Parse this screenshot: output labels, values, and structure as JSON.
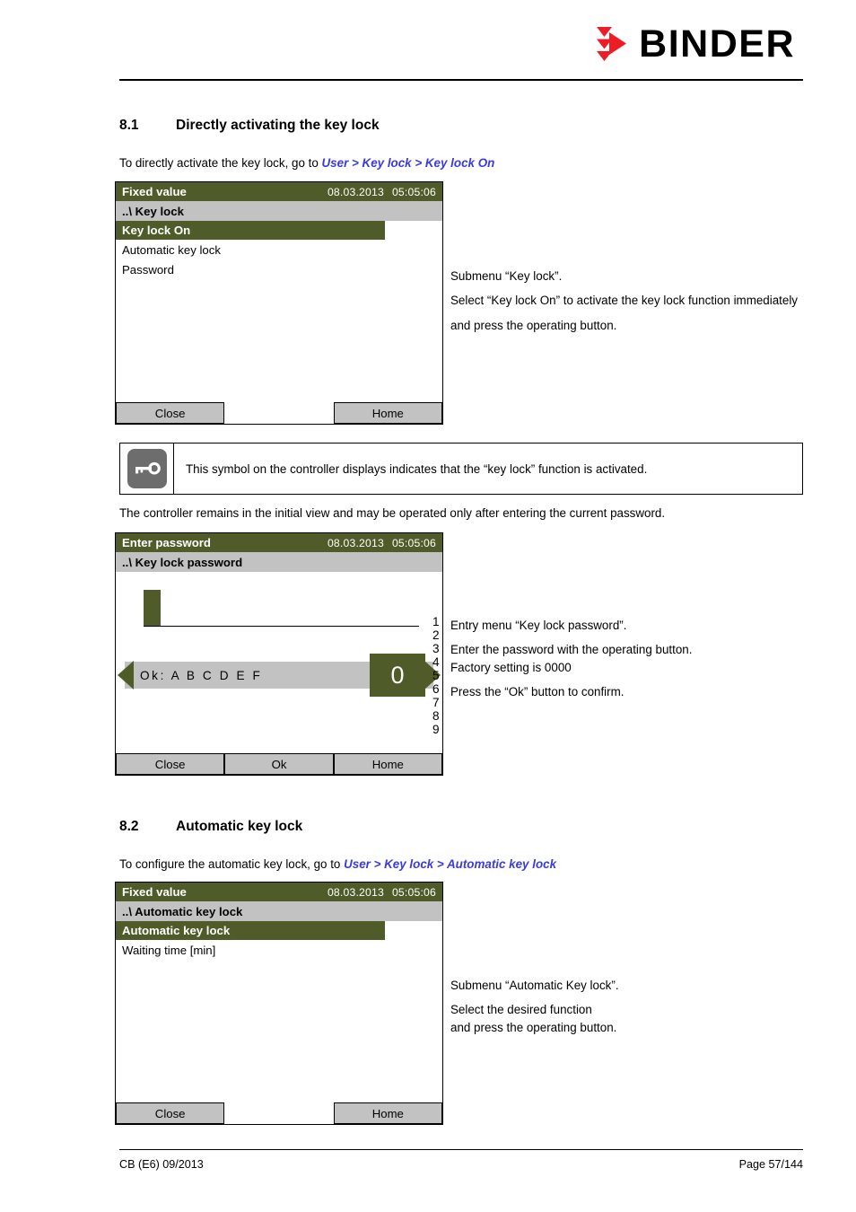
{
  "brand": {
    "name": "BINDER",
    "mark_color": "#ee1c24"
  },
  "sections": [
    {
      "number": "8.1",
      "title": "Directly activating the key lock",
      "intro_prefix": "To directly activate the key lock, go to ",
      "intro_path": "User > Key lock > Key lock On"
    },
    {
      "number": "8.2",
      "title": "Automatic key lock",
      "intro_prefix": "To configure the automatic key lock, go to ",
      "intro_path": "User > Key lock > Automatic key lock"
    }
  ],
  "panel_keylock": {
    "title": "Fixed value",
    "date": "08.03.2013",
    "time": "05:05:06",
    "breadcrumb": "..\\ Key lock",
    "selected_row": "Key lock On",
    "rows": [
      "Automatic key lock",
      "Password"
    ],
    "buttons": {
      "close": "Close",
      "home": "Home"
    }
  },
  "panel_password": {
    "title": "Enter password",
    "date": "08.03.2013",
    "time": "05:05:06",
    "breadcrumb": "..\\ Key lock password",
    "char_left": "Ok: A B C D E F",
    "char_selected": "0",
    "char_right": "1 2 3 4 5 6 7 8 9",
    "buttons": {
      "close": "Close",
      "ok": "Ok",
      "home": "Home"
    }
  },
  "panel_autolock": {
    "title": "Fixed value",
    "date": "08.03.2013",
    "time": "05:05:06",
    "breadcrumb": "..\\ Automatic key lock",
    "selected_row": "Automatic key lock",
    "rows": [
      "Waiting time [min]"
    ],
    "buttons": {
      "close": "Close",
      "home": "Home"
    }
  },
  "notes": {
    "keylock": {
      "line1": "Submenu “Key lock”.",
      "line2": "Select “Key lock On” to activate the key lock function immediately",
      "line3": "and press the operating button."
    },
    "password": {
      "line1": "Entry menu “Key lock password”.",
      "line2": "Enter the password with the operating button.",
      "line3": "Factory setting is 0000",
      "line4": "Press the “Ok” button to confirm."
    },
    "autolock": {
      "line1": "Submenu “Automatic Key lock”.",
      "line2": "Select the desired function",
      "line3": "and press the operating button."
    }
  },
  "symbol_note": {
    "text": "This symbol on the controller displays indicates that the “key lock” function is activated."
  },
  "body_text": {
    "after_symbol": "The controller remains in the initial view and may be operated only after entering the current password."
  },
  "footer": {
    "left": "CB (E6) 09/2013",
    "right": "Page 57/144"
  }
}
